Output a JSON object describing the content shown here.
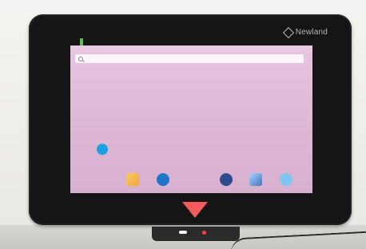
{
  "brand": {
    "logo_text": "Newland"
  },
  "screen": {
    "status_time": "",
    "search_placeholder": ""
  },
  "colors": {
    "screen_bg": "#ddb8d5",
    "triangle": "#f15b5b",
    "bezel": "#151515"
  },
  "icons": {
    "brand": "newland-logo-icon",
    "search": "search-icon",
    "contacts": "contacts-icon",
    "dock": [
      "email-icon",
      "browser-icon",
      "camera-icon",
      "gallery-icon",
      "music-icon"
    ]
  }
}
